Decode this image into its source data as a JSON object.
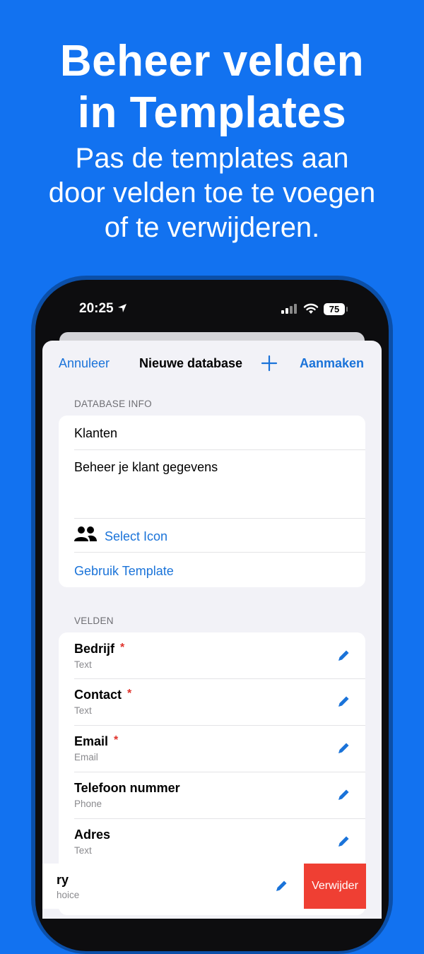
{
  "promo": {
    "headline_line1": "Beheer velden",
    "headline_line2": "in Templates",
    "subtitle_line1": "Pas de templates aan",
    "subtitle_line2": "door velden toe te voegen",
    "subtitle_line3": "of te verwijderen."
  },
  "status_bar": {
    "time": "20:25",
    "battery": "75",
    "icons": [
      "location-arrow-icon",
      "cellular-signal-icon",
      "wifi-icon",
      "battery-icon"
    ]
  },
  "nav": {
    "cancel_label": "Annuleer",
    "title": "Nieuwe database",
    "add_icon": "plus-icon",
    "create_label": "Aanmaken"
  },
  "database_info": {
    "header": "DATABASE INFO",
    "name_value": "Klanten",
    "description_value": "Beheer je klant gegevens",
    "select_icon_label": "Select Icon",
    "icon": "people-icon",
    "template_label": "Gebruik Template"
  },
  "fields": {
    "header": "VELDEN",
    "items": [
      {
        "name": "Bedrijf",
        "required": "*",
        "type": "Text"
      },
      {
        "name": "Contact",
        "required": "*",
        "type": "Text"
      },
      {
        "name": "Email",
        "required": "*",
        "type": "Email"
      },
      {
        "name": "Telefoon nummer",
        "required": "",
        "type": "Phone"
      },
      {
        "name": "Adres",
        "required": "",
        "type": "Text"
      }
    ],
    "swiped_item": {
      "name": "ry",
      "type": "hoice"
    },
    "delete_label": "Verwijder"
  },
  "colors": {
    "background": "#1272f0",
    "accent": "#1a73d9",
    "destructive": "#ef3f33",
    "required": "#e0322b"
  }
}
